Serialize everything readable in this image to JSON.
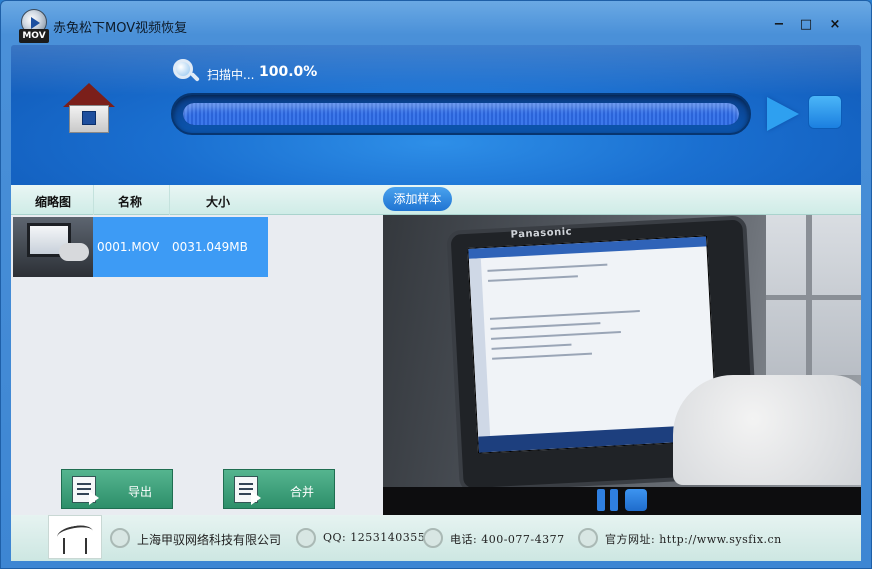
{
  "window": {
    "title": "赤兔松下MOV视频恢复",
    "logo_tag": "MOV",
    "minimize_glyph": "−",
    "maximize_glyph": "□",
    "close_glyph": "×"
  },
  "scan": {
    "label": "扫描中...",
    "percent": "100.0%",
    "progress_fraction": 1.0
  },
  "columns": {
    "thumbnail": "缩略图",
    "name": "名称",
    "size": "大小",
    "add_sample": "添加样本"
  },
  "files": [
    {
      "name": "0001.MOV",
      "size": "0031.049MB"
    }
  ],
  "actions": {
    "export": "导出",
    "merge": "合并"
  },
  "preview": {
    "brand": "Panasonic"
  },
  "footer": {
    "company": "上海甲驭网络科技有限公司",
    "qq": "QQ: 1253140355",
    "phone": "电话: 400-077-4377",
    "website": "官方网址: http://www.sysfix.cn"
  },
  "colors": {
    "header_blue": "#1a6fd0",
    "selected_row": "#3d9bf5",
    "action_green": "#2d8f6a"
  }
}
